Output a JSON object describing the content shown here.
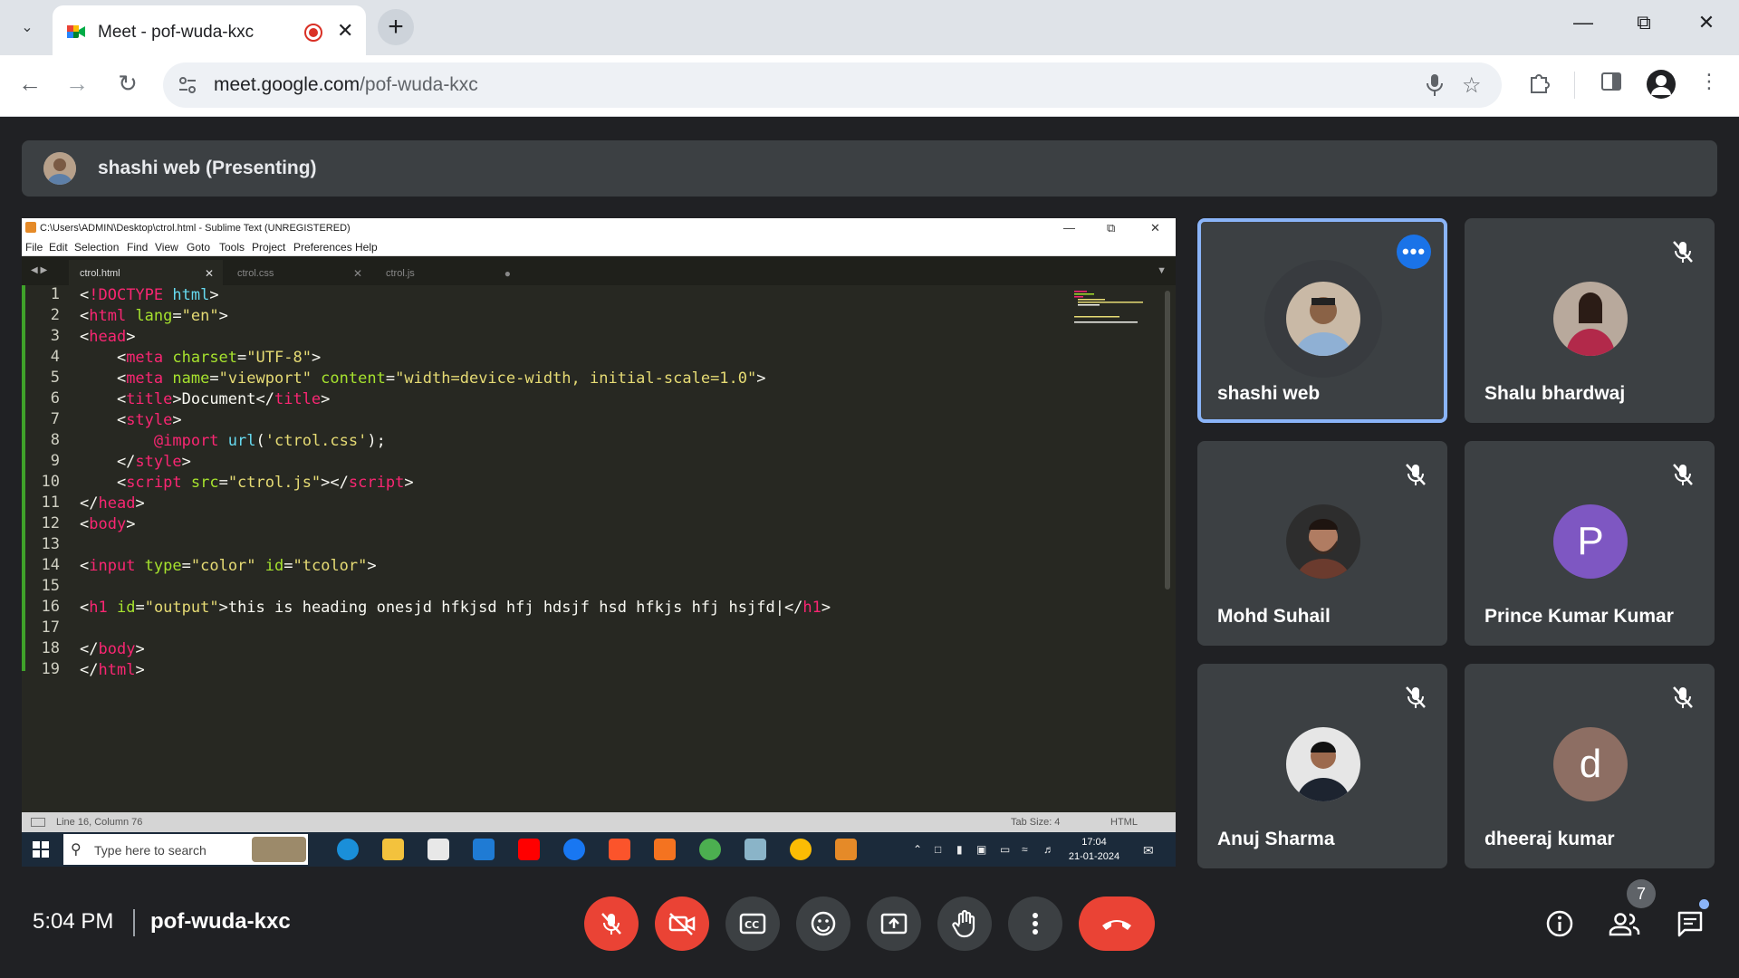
{
  "browser": {
    "tab_title": "Meet - pof-wuda-kxc",
    "url_domain": "meet.google.com",
    "url_path": "/pof-wuda-kxc"
  },
  "presenting_banner": "shashi web (Presenting)",
  "shared_screen": {
    "window_title": "C:\\Users\\ADMIN\\Desktop\\ctrol.html - Sublime Text (UNREGISTERED)",
    "menu": [
      "File",
      "Edit",
      "Selection",
      "Find",
      "View",
      "Goto",
      "Tools",
      "Project",
      "Preferences",
      "Help"
    ],
    "tabs": [
      "ctrol.html",
      "ctrol.css",
      "ctrol.js"
    ],
    "line_numbers": [
      "1",
      "2",
      "3",
      "4",
      "5",
      "6",
      "7",
      "8",
      "9",
      "10",
      "11",
      "12",
      "13",
      "14",
      "15",
      "16",
      "17",
      "18",
      "19"
    ],
    "status_position": "Line 16, Column 76",
    "status_tab_size": "Tab Size: 4",
    "status_syntax": "HTML",
    "taskbar_search": "Type here to search",
    "clock_time": "17:04",
    "clock_date": "21-01-2024"
  },
  "participants": [
    {
      "name": "shashi web",
      "speaking": true
    },
    {
      "name": "Shalu bhardwaj"
    },
    {
      "name": "Mohd Suhail"
    },
    {
      "name": "Prince Kumar Kumar",
      "initial": "P",
      "color": "#7e57c2"
    },
    {
      "name": "Anuj Sharma"
    },
    {
      "name": "dheeraj kumar",
      "initial": "d",
      "color": "#8d6e63"
    }
  ],
  "meeting": {
    "time": "5:04 PM",
    "code": "pof-wuda-kxc",
    "participant_count": "7"
  },
  "colors": {
    "mic_off": "#ea4335",
    "hangup": "#ea4335",
    "active_border": "#8ab4f8"
  }
}
